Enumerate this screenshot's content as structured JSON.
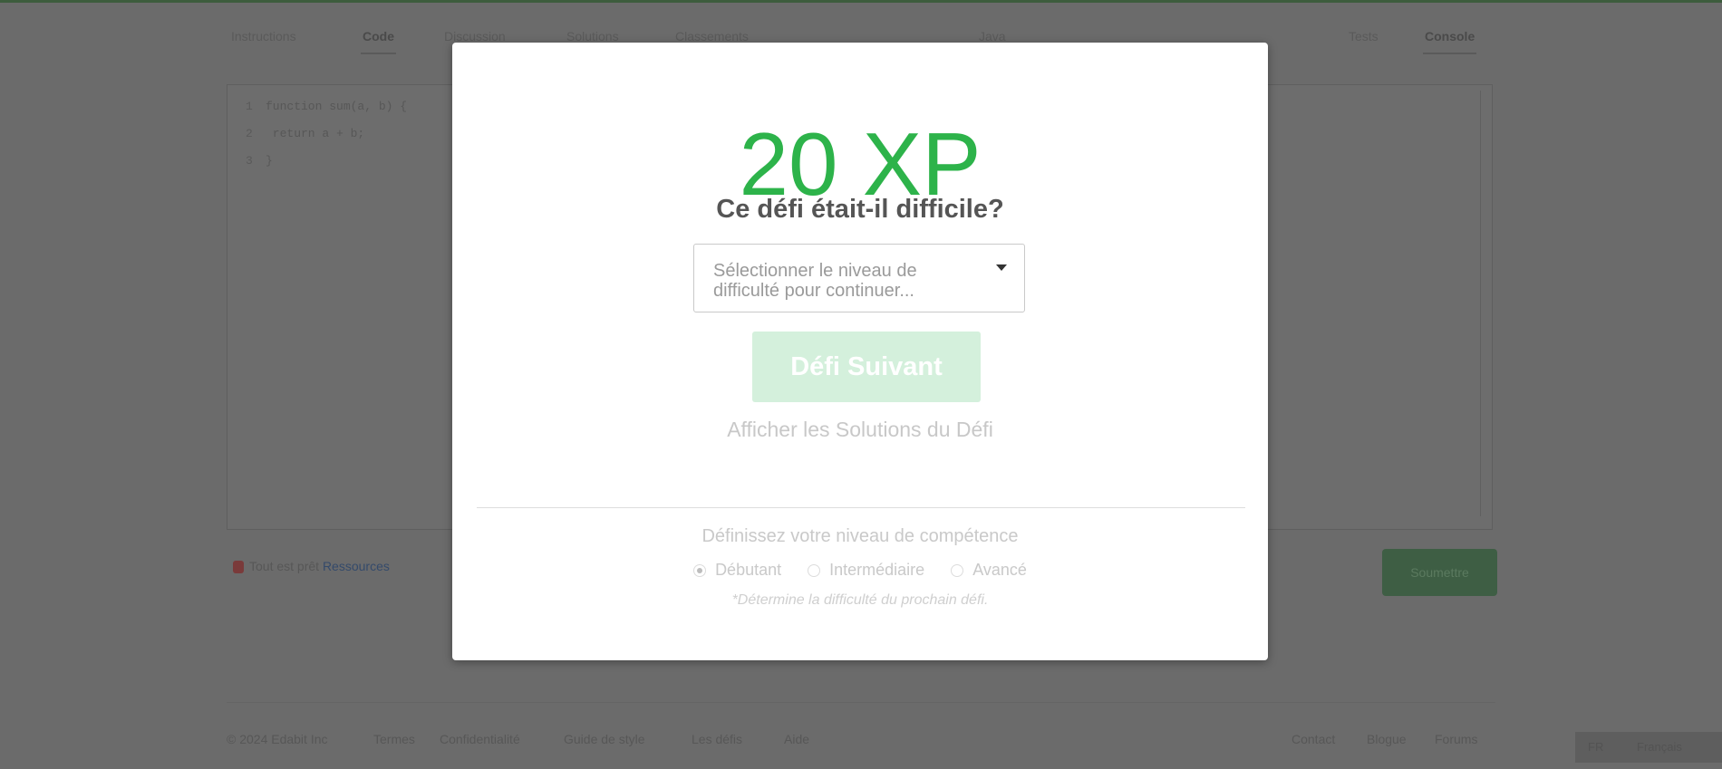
{
  "background": {
    "tabs": [
      {
        "label": "Instructions",
        "active": false
      },
      {
        "label": "Code",
        "active": true
      },
      {
        "label": "Discussion",
        "active": false
      },
      {
        "label": "Solutions",
        "active": false
      },
      {
        "label": "Classements",
        "active": false
      }
    ],
    "right_tabs": [
      {
        "label": "Tests",
        "active": false
      },
      {
        "label": "Console",
        "active": true
      }
    ],
    "lang_label": "Java",
    "code_lines": [
      {
        "num": "1",
        "text": "function sum(a, b) {"
      },
      {
        "num": "2",
        "text": "  return a + b;"
      },
      {
        "num": "3",
        "text": "}"
      }
    ],
    "status_text": "Tout est prêt",
    "status_link": "Ressources",
    "run_label": "Soumettre",
    "footer_left": [
      "© 2024 Edabit Inc",
      "Termes",
      "Confidentialité",
      "Guide de style",
      "Les défis",
      "Aide"
    ],
    "footer_right": [
      "Contact",
      "Blogue",
      "Forums"
    ],
    "lang_box": [
      "FR",
      "Français"
    ]
  },
  "modal": {
    "xp": "20 XP",
    "question": "Ce défi était-il difficile?",
    "select_placeholder": "Sélectionner le niveau de difficulté pour continuer...",
    "next_button": "Défi Suivant",
    "solutions_link": "Afficher les Solutions du Défi",
    "skill_title": "Définissez votre niveau de compétence",
    "skill_options": [
      {
        "label": "Débutant",
        "checked": true
      },
      {
        "label": "Intermédiaire",
        "checked": false
      },
      {
        "label": "Avancé",
        "checked": false
      }
    ],
    "skill_note": "*Détermine la difficulté du prochain défi."
  },
  "colors": {
    "xp_green": "#2db34a",
    "overlay": "#6b6b6b",
    "button_disabled": "#d4f0dc"
  }
}
